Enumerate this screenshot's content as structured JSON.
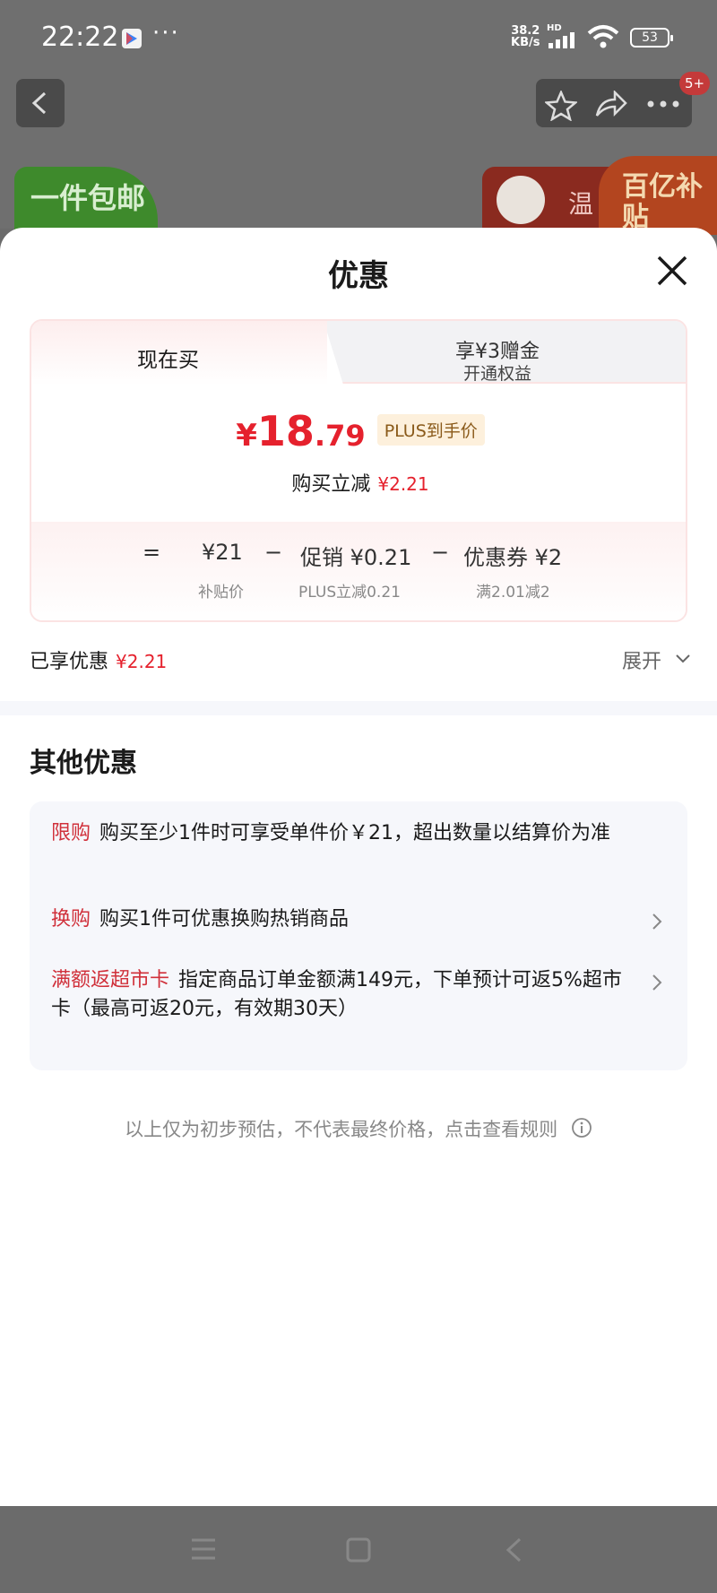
{
  "status_bar": {
    "time": "22:22",
    "dots": "···",
    "net_speed_value": "38.2",
    "net_speed_unit": "KB/s",
    "hd": "HD",
    "battery": "53"
  },
  "background": {
    "badge": "5+",
    "promo_left": "一件包邮",
    "promo_right_warm": "温",
    "promo_right_subsidy": "百亿补贴"
  },
  "sheet": {
    "title": "优惠",
    "tabs": {
      "now": "现在买",
      "other_line1": "享¥3赠金",
      "other_line2": "开通权益"
    },
    "price": {
      "yen": "¥",
      "integer": "18",
      "decimal": ".79",
      "tag": "PLUS到手价"
    },
    "reduce": {
      "label": "购买立减",
      "value": "¥2.21"
    },
    "breakdown": {
      "equals": "=",
      "base": "¥21",
      "base_sub": "补贴价",
      "minus1": "−",
      "promo": "促销 ¥0.21",
      "promo_sub": "PLUS立减0.21",
      "minus2": "−",
      "coupon": "优惠券 ¥2",
      "coupon_sub": "满2.01减2"
    },
    "enjoyed": {
      "label": "已享优惠",
      "value": "¥2.21",
      "expand": "展开"
    },
    "other": {
      "title": "其他优惠",
      "offers": [
        {
          "tag": "限购",
          "text": "购买至少1件时可享受单件价￥21，超出数量以结算价为准"
        },
        {
          "tag": "换购",
          "text": "购买1件可优惠换购热销商品"
        },
        {
          "tag": "满额返超市卡",
          "text": "指定商品订单金额满149元，下单预计可返5%超市卡（最高可返20元，有效期30天）"
        }
      ]
    },
    "hint": "以上仅为初步预估，不代表最终价格，点击查看规则"
  }
}
